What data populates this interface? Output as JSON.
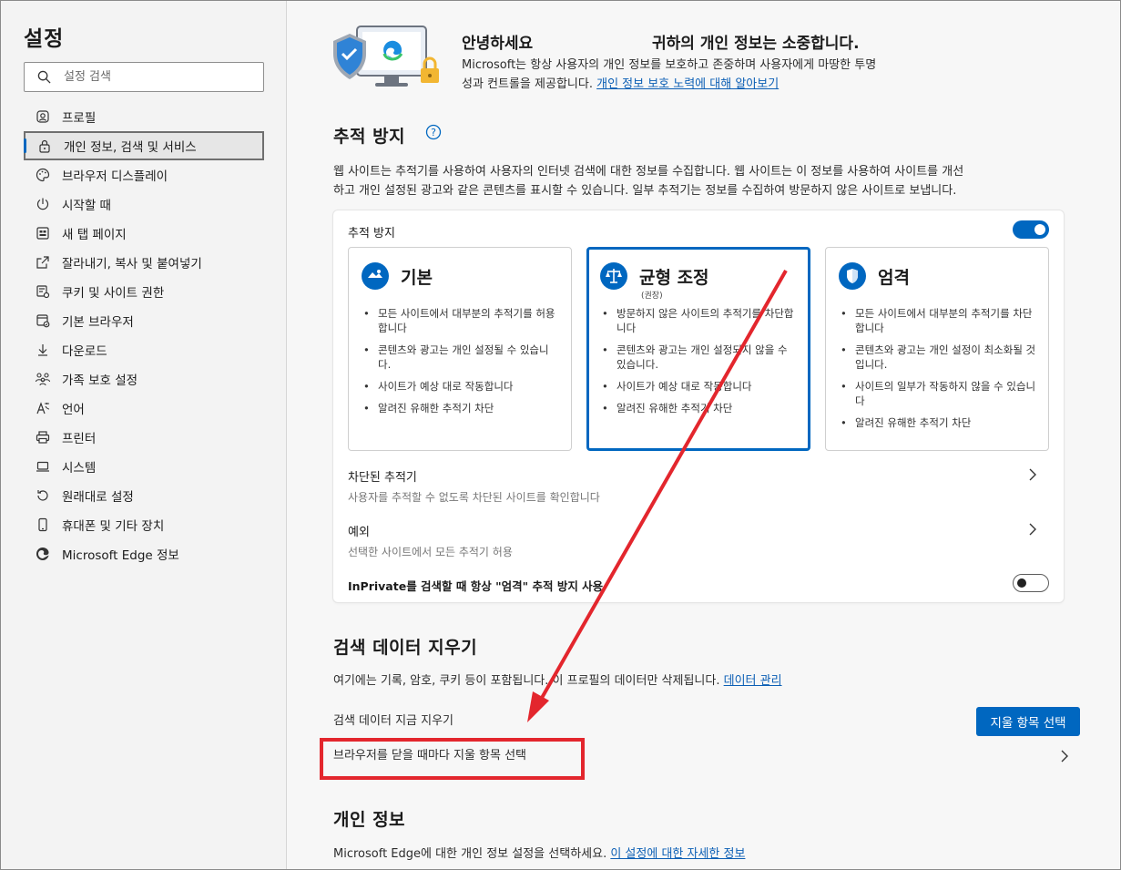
{
  "sidebar": {
    "title": "설정",
    "search_placeholder": "설정 검색",
    "items": [
      {
        "label": "프로필",
        "icon": "profile-icon"
      },
      {
        "label": "개인 정보, 검색 및 서비스",
        "icon": "lock-icon",
        "active": true
      },
      {
        "label": "브라우저 디스플레이",
        "icon": "palette-icon"
      },
      {
        "label": "시작할 때",
        "icon": "power-icon"
      },
      {
        "label": "새 탭 페이지",
        "icon": "new-tab-icon"
      },
      {
        "label": "잘라내기, 복사 및 붙여넣기",
        "icon": "share-icon"
      },
      {
        "label": "쿠키 및 사이트 권한",
        "icon": "cookie-icon"
      },
      {
        "label": "기본 브라우저",
        "icon": "browser-icon"
      },
      {
        "label": "다운로드",
        "icon": "download-icon"
      },
      {
        "label": "가족 보호 설정",
        "icon": "family-icon"
      },
      {
        "label": "언어",
        "icon": "language-icon"
      },
      {
        "label": "프린터",
        "icon": "printer-icon"
      },
      {
        "label": "시스템",
        "icon": "laptop-icon"
      },
      {
        "label": "원래대로 설정",
        "icon": "reset-icon"
      },
      {
        "label": "휴대폰 및 기타 장치",
        "icon": "phone-icon"
      },
      {
        "label": "Microsoft Edge 정보",
        "icon": "edge-icon"
      }
    ]
  },
  "hero": {
    "hello": "안녕하세요",
    "title": "귀하의 개인 정보는 소중합니다.",
    "desc_line1": "Microsoft는 항상 사용자의 개인 정보를 보호하고 존중하며 사용자에게 마땅한 투명",
    "desc_line2": "성과 컨트롤을 제공합니다.",
    "link": "개인 정보 보호 노력에 대해 알아보기"
  },
  "tracking": {
    "heading": "추적 방지",
    "desc_line1": "웹 사이트는 추적기를 사용하여 사용자의 인터넷 검색에 대한 정보를 수집합니다. 웹 사이트는 이 정보를 사용하여 사이트를 개선",
    "desc_line2": "하고 개인 설정된 광고와 같은 콘텐츠를 표시할 수 있습니다. 일부 추적기는 정보를 수집하여 방문하지 않은 사이트로 보냅니다.",
    "card_label": "추적 방지",
    "toggle_on": true,
    "options": [
      {
        "title": "기본",
        "sub": "",
        "bullets": [
          "모든 사이트에서 대부분의 추적기를 허용합니다",
          "콘텐츠와 광고는 개인 설정될 수 있습니다.",
          "사이트가 예상 대로 작동합니다",
          "알려진 유해한 추적기 차단"
        ]
      },
      {
        "title": "균형 조정",
        "sub": "(권장)",
        "bullets": [
          "방문하지 않은 사이트의 추적기를 차단합니다",
          "콘텐츠와 광고는 개인 설정되지 않을 수 있습니다.",
          "사이트가 예상 대로 작동합니다",
          "알려진 유해한 추적기 차단"
        ]
      },
      {
        "title": "엄격",
        "sub": "",
        "bullets": [
          "모든 사이트에서 대부분의 추적기를 차단합니다",
          "콘텐츠와 광고는 개인 설정이 최소화될 것입니다.",
          "사이트의 일부가 작동하지 않을 수 있습니다",
          "알려진 유해한 추적기 차단"
        ]
      }
    ],
    "blocked_title": "차단된 추적기",
    "blocked_sub": "사용자를 추적할 수 없도록 차단된 사이트를 확인합니다",
    "exceptions_title": "예외",
    "exceptions_sub": "선택한 사이트에서 모든 추적기 허용",
    "inprivate_label": "InPrivate를 검색할 때 항상 \"엄격\" 추적 방지 사용",
    "inprivate_on": false
  },
  "clear": {
    "heading": "검색 데이터 지우기",
    "desc": "여기에는 기록, 암호, 쿠키 등이 포함됩니다. 이 프로필의 데이터만 삭제됩니다.",
    "link": "데이터 관리",
    "now_label": "검색 데이터 지금 지우기",
    "button": "지울 항목 선택",
    "on_close_label": "브라우저를 닫을 때마다 지울 항목 선택"
  },
  "privacy": {
    "heading": "개인 정보",
    "desc": "Microsoft Edge에 대한 개인 정보 설정을 선택하세요.",
    "link": "이 설정에 대한 자세한 정보"
  },
  "annotation": {
    "arrow_color": "#e3262d",
    "box_color": "#e3262d"
  },
  "colors": {
    "accent": "#0067c0"
  }
}
